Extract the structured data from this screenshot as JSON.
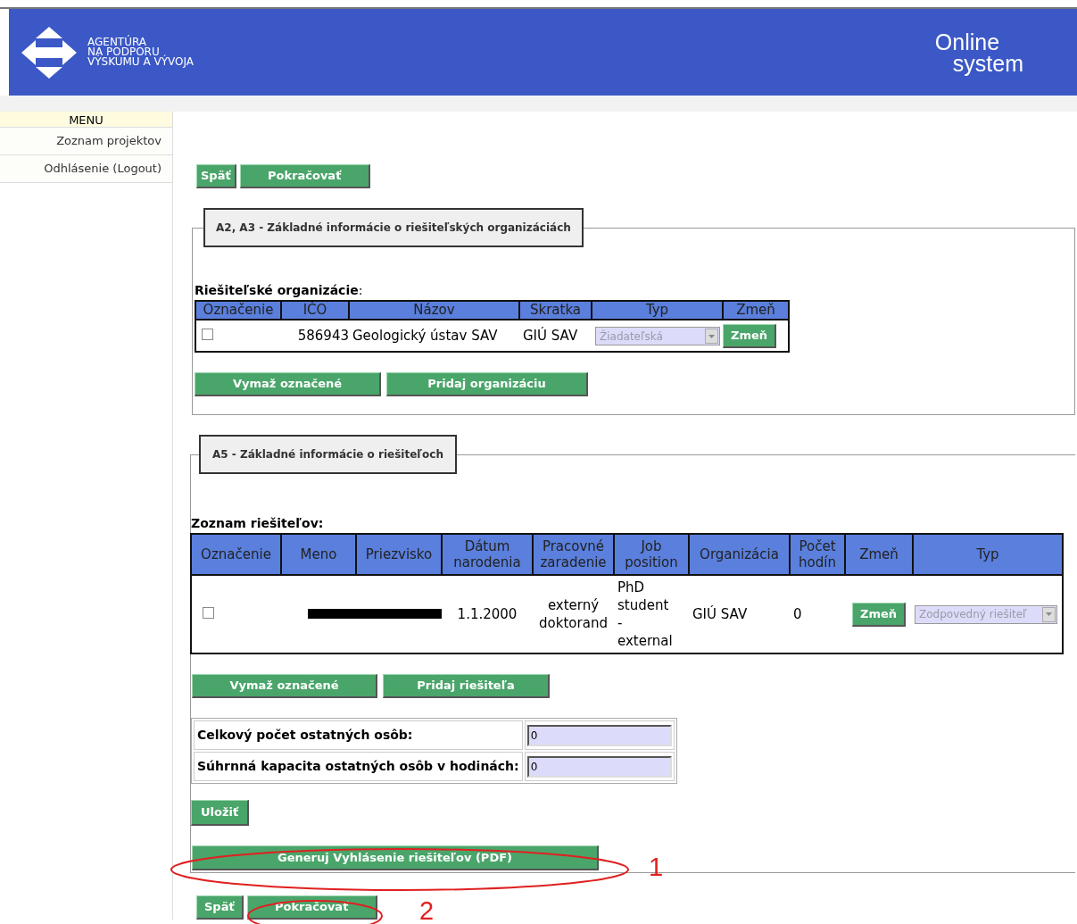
{
  "header": {
    "logo_lines": [
      "AGENTÚRA",
      "NA PODPORU",
      "VÝSKUMU A VÝVOJA"
    ],
    "brand_top": "Online",
    "brand_bottom": "system"
  },
  "menu": {
    "title": "MENU",
    "items": [
      {
        "label": "Zoznam projektov"
      },
      {
        "label": "Odhlásenie (Logout)"
      }
    ]
  },
  "top_nav": [
    "Späť",
    "Pokračovať"
  ],
  "organizations": {
    "legend": "A2, A3 - Základné informácie o riešiteľských organizáciách",
    "table_title": "**Riešiteľské organizácie**:",
    "columns": [
      "Označenie",
      "IČO",
      "Názov",
      "Skratka",
      "Typ",
      "Zmeň"
    ],
    "rows": [
      {
        "checked": false,
        "ico": "586943",
        "name": "Geologický ústav SAV",
        "abbr": "GIÚ SAV",
        "type": {
          "value": "Žiadateľská",
          "disabled": true
        },
        "action": "Zmeň"
      }
    ],
    "buttons": [
      "Vymaž označené",
      "Pridaj organizáciu"
    ]
  },
  "researchers": {
    "legend": "A5 - Základné informácie o riešiteľoch",
    "table_title": "Zoznam riešiteľov:",
    "columns": [
      [
        "Označenie"
      ],
      [
        "Meno"
      ],
      [
        "Priezvisko"
      ],
      [
        "Dátum",
        "narodenia"
      ],
      [
        "Pracovné",
        "zaradenie"
      ],
      [
        "Job",
        "position"
      ],
      [
        "Organizácia"
      ],
      [
        "Počet",
        "hodín"
      ],
      [
        "Zmeň"
      ],
      [
        "Typ"
      ]
    ],
    "rows": [
      {
        "checked": false,
        "birth_date": "1.1.2000",
        "position": [
          "externý",
          "doktorand"
        ],
        "job_position": [
          "PhD",
          "student",
          "-",
          "external"
        ],
        "organization": "GIÚ SAV",
        "hours": "0",
        "action": "Zmeň",
        "type": {
          "value": "Zodpovedný riešiteľ",
          "disabled": true
        }
      }
    ],
    "buttons": [
      "Vymaž označené",
      "Pridaj riešiteľa"
    ],
    "fields": [
      {
        "label": "Celkový počet ostatných osôb:",
        "value": "0"
      },
      {
        "label": "Súhrnná kapacita ostatných osôb v hodinách:",
        "value": "0"
      }
    ],
    "save": "Uložiť",
    "generate": "Generuj Vyhlásenie riešiteľov (PDF)"
  },
  "bottom_nav": [
    "Späť",
    "Pokračovať"
  ],
  "annotations": [
    {
      "number": "1"
    },
    {
      "number": "2"
    }
  ]
}
